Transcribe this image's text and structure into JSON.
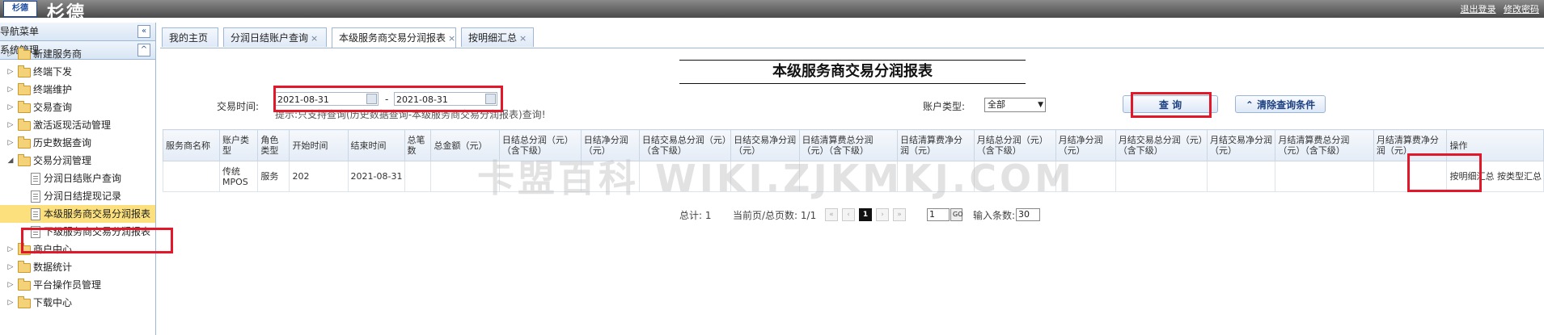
{
  "header": {
    "brand": "杉德",
    "logo_text": "杉德",
    "logout": "退出登录",
    "change_password": "修改密码"
  },
  "sidebar": {
    "nav_title": "导航菜单",
    "nav_collapse": "«",
    "section_title": "系统管理",
    "section_collapse": "^",
    "items": [
      {
        "label": "新建服务商"
      },
      {
        "label": "终端下发"
      },
      {
        "label": "终端维护"
      },
      {
        "label": "交易查询"
      },
      {
        "label": "激活返现活动管理"
      },
      {
        "label": "历史数据查询"
      },
      {
        "label": "交易分润管理"
      },
      {
        "label": "分润日结账户查询"
      },
      {
        "label": "分润日结提现记录"
      },
      {
        "label": "本级服务商交易分润报表"
      },
      {
        "label": "下级服务商交易分润报表"
      },
      {
        "label": "商户中心"
      },
      {
        "label": "数据统计"
      },
      {
        "label": "平台操作员管理"
      },
      {
        "label": "下载中心"
      }
    ]
  },
  "tabs": [
    {
      "label": "我的主页",
      "close": ""
    },
    {
      "label": "分润日结账户查询",
      "close": "×"
    },
    {
      "label": "本级服务商交易分润报表",
      "close": "×"
    },
    {
      "label": "按明细汇总",
      "close": "×"
    }
  ],
  "report": {
    "title": "本级服务商交易分润报表",
    "date_label": "交易时间:",
    "date_from": "2021-08-31",
    "date_separator": "-",
    "date_to": "2021-08-31",
    "notice": "提示:只支持查询(历史数据查询-本级服务商交易分润报表)查询!",
    "account_type_label": "账户类型:",
    "account_type_value": "全部",
    "query_button": "查 询",
    "clear_button": "清除查询条件"
  },
  "table": {
    "columns": [
      "服务商名称",
      "账户类型",
      "角色类型",
      "开始时间",
      "结束时间",
      "总笔数",
      "总金额（元）",
      "日结总分润（元）（含下级）",
      "日结净分润（元）",
      "日结交易总分润（元）（含下级）",
      "日结交易净分润（元）",
      "日结清算费总分润（元）（含下级）",
      "日结清算费净分润（元）",
      "月结总分润（元）（含下级）",
      "月结净分润（元）",
      "月结交易总分润（元）（含下级）",
      "月结交易净分润（元）",
      "月结清算费总分润（元）（含下级）",
      "月结清算费净分润（元）",
      "操作"
    ],
    "rows": [
      [
        "",
        "传统MPOS",
        "服务",
        "202",
        "2021-08-31",
        "",
        "",
        "",
        "",
        "",
        "",
        "",
        "",
        "",
        "",
        "",
        "",
        "",
        "",
        "按明细汇总 按类型汇总"
      ]
    ]
  },
  "pager": {
    "total": "总计: 1",
    "page_info": "当前页/总页数: 1/1",
    "first": "«",
    "prev": "‹",
    "current": "1",
    "next": "›",
    "last": "»",
    "goto_value": "1",
    "go_label": "GO",
    "rows_label": "输入条数:",
    "rows_value": "30"
  },
  "watermark": "卡盟百科 WIKI.ZJKMKJ.COM",
  "colors": {
    "highlight_red": "#e1182a",
    "selected_item": "#fbe07d",
    "border_blue": "#9fb7d6"
  }
}
